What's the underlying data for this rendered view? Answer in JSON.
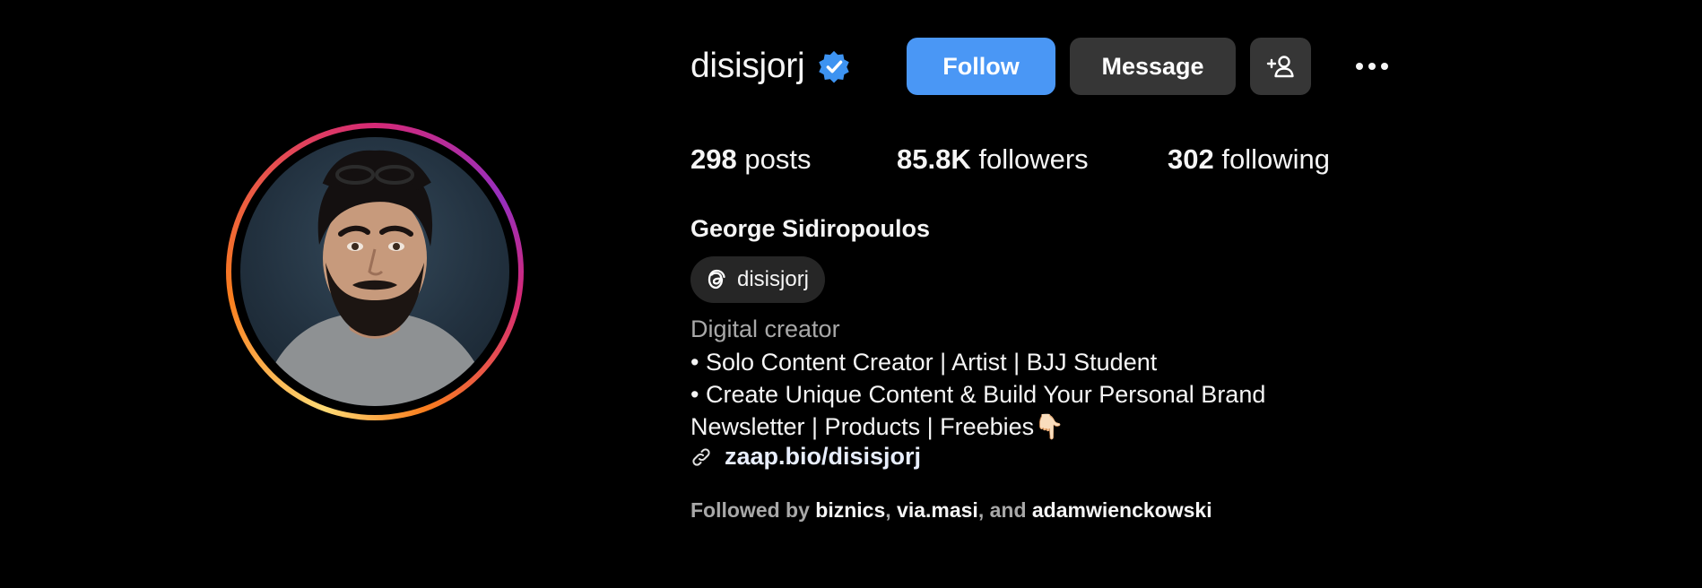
{
  "profile": {
    "username": "disisjorj",
    "full_name": "George Sidiropoulos",
    "threads_handle": "disisjorj",
    "category": "Digital creator",
    "bio_lines": [
      "• Solo Content Creator | Artist | BJJ Student",
      "• Create Unique Content & Build Your Personal Brand",
      "Newsletter | Products | Freebies👇🏻"
    ],
    "link": "zaap.bio/disisjorj"
  },
  "actions": {
    "follow_label": "Follow",
    "message_label": "Message"
  },
  "stats": {
    "posts_count": "298",
    "posts_label": "posts",
    "followers_count": "85.8K",
    "followers_label": "followers",
    "following_count": "302",
    "following_label": "following"
  },
  "followed_by": {
    "prefix": "Followed by",
    "accounts": [
      "biznics",
      "via.masi",
      "adamwienckowski"
    ],
    "sep1": ",",
    "sep2": ", and"
  },
  "icons": {
    "verified": "verified-badge-icon",
    "add_user": "add-user-icon",
    "more": "more-options-icon",
    "threads": "threads-icon",
    "link": "link-icon"
  },
  "colors": {
    "background": "#000000",
    "follow_button": "#4a97f5",
    "secondary_button": "#363636",
    "verified": "#3d93f1",
    "muted_text": "#a8a8a8"
  }
}
